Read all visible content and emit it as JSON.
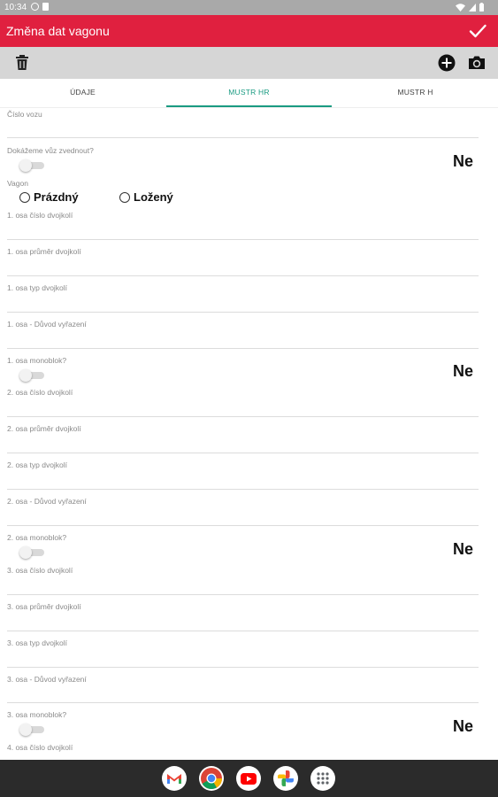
{
  "status_bar": {
    "time": "10:34"
  },
  "app_bar": {
    "title": "Změna dat vagonu"
  },
  "tabs": [
    {
      "label": "ÚDAJE"
    },
    {
      "label": "MUSTR HR"
    },
    {
      "label": "MUSTR H"
    }
  ],
  "active_tab": "MUSTR HR",
  "form": {
    "cislo_vozu": {
      "label": "Číslo vozu",
      "value": ""
    },
    "zvednout": {
      "label": "Dokážeme vůz zvednout?",
      "value": "Ne",
      "checked": false
    },
    "vagon": {
      "label": "Vagon",
      "options": [
        "Prázdný",
        "Ložený"
      ],
      "selected": null
    },
    "axles": [
      {
        "cislo": "1. osa číslo dvojkolí",
        "prumer": "1. osa průměr dvojkolí",
        "typ": "1. osa typ dvojkolí",
        "duvod": "1. osa - Důvod vyřazení",
        "monoblok": "1. osa monoblok?",
        "monoblok_value": "Ne"
      },
      {
        "cislo": "2. osa číslo dvojkolí",
        "prumer": "2. osa průměr dvojkolí",
        "typ": "2. osa typ dvojkolí",
        "duvod": "2. osa - Důvod vyřazení",
        "monoblok": "2. osa monoblok?",
        "monoblok_value": "Ne"
      },
      {
        "cislo": "3. osa číslo dvojkolí",
        "prumer": "3. osa průměr dvojkolí",
        "typ": "3. osa typ dvojkolí",
        "duvod": "3. osa - Důvod vyřazení",
        "monoblok": "3. osa monoblok?",
        "monoblok_value": "Ne"
      },
      {
        "cislo": "4. osa číslo dvojkolí"
      }
    ]
  },
  "toolbar": {
    "icons": [
      "trash-icon",
      "add-circle-icon",
      "camera-icon"
    ]
  },
  "dock": {
    "apps": [
      "gmail-icon",
      "chrome-icon",
      "youtube-icon",
      "photos-icon",
      "app-drawer-icon"
    ]
  },
  "colors": {
    "app_bar": "#e0203f",
    "accent": "#1a9b82",
    "toolbar": "#d6d6d6",
    "status_bar": "#a9a9a9",
    "dock": "#2b2b2b"
  }
}
